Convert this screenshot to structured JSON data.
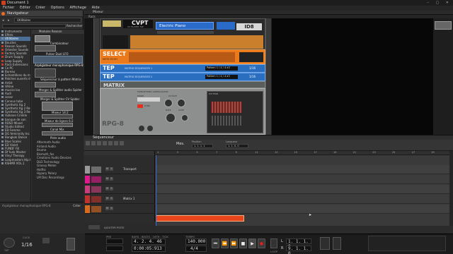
{
  "window": {
    "title": "Document 1",
    "controls": "– ▢ ✕"
  },
  "menu": [
    "Fichier",
    "Editer",
    "Créer",
    "Options",
    "Affichage",
    "Aide"
  ],
  "browser": {
    "title": "Navigateur",
    "search_field": "Utilitaires",
    "location_label": "Rechercher",
    "locations": [
      "Instruments",
      "Effets",
      "Utilitaires",
      "Boucles",
      "Reason Sounds",
      "Orkester Sounds",
      "Factory Sounds",
      "Drum Supply",
      "Loop Supply",
      "Rack Extensions",
      "Ce PC",
      "Bureau",
      "Echantillons du modèle",
      "Patches ouverts dans",
      "Artist",
      "Véline",
      "musics loo",
      "Audi",
      "sonar",
      "Connus tube",
      "Synthetic Kg 2",
      "Synthetic Kg 2 ReFill",
      "Synthetic Kg 3 ReFill",
      "Vulkane Crinkle",
      "banque de son",
      "RDSO Mixed",
      "Studio Edited",
      "ED Femme",
      "DG femininity Inc",
      "Bangkok Dance",
      "Blue Scales",
      "ED Violet",
      "FUNDF Fill",
      "Df funk Master",
      "Vinyl Therapy",
      "Loopmasters Hip Hop",
      "KSHMR VOL.1"
    ],
    "selected_location": "Utilitaires",
    "column_header": "Modules Reason",
    "devices": [
      "Combinateur",
      "Pulsar Dual LFO",
      "Arpégiateur monophonique RPG-8",
      "Séquenceur à pattern Matrix",
      "Merger & Splitter audio Spider",
      "Merger & Splitter CV Spider",
      "Mixeur 14:2",
      "Mixeur de lignes 6:2",
      "Canal Mix",
      "Piste audio"
    ],
    "more_items": [
      "Aftermath Audio",
      "Airland Audio",
      "Brume",
      "Bismuth_fas",
      "Creations Audio Devices",
      "DLD Technology",
      "Groovy Melon",
      "Halfhz",
      "Hypary Polary",
      "LM Disc Recordings"
    ],
    "footer": "Arpégiateur monophonique RPG-8",
    "footer_button": "Créer"
  },
  "rack": {
    "title": "Mixeur",
    "sub": "Rack",
    "cv_player": {
      "brand": "CVPT",
      "model": "CV PLAYER TAP",
      "id_badge": "ID8",
      "patch": "Electric Piano",
      "pan_label": "Pan",
      "vol_label": "Volume"
    },
    "select": {
      "name": "SELECT",
      "sub": "NOTE ECHO"
    },
    "step_modules": [
      {
        "name": "TEP",
        "label": "MATRIX SEQUENCER 1",
        "field": "Pattern 1 / 4 / 4 a3",
        "value": "1/16"
      },
      {
        "name": "TEP",
        "label": "MATRIX SEQUENCER 2",
        "field": "Pattern 1 / 4 / 4 a3",
        "value": "1/16"
      }
    ],
    "matrix": {
      "name": "MATRIX"
    },
    "arpeggiator": {
      "name": "RPG-8",
      "title": "MONOPHONIC ARPEGGIATOR",
      "mode_label": "MODE",
      "rate_label": "RATE",
      "gate_label": "GATE",
      "octave_label": "OCTAVE",
      "sync_label": "SYNC",
      "pattern_label": "PATTERN"
    }
  },
  "sequencer": {
    "title": "Séquenceur",
    "tools": [
      "Mes.",
      "Position",
      "Longueur"
    ],
    "position": "1.  1.  1.  1",
    "length": "1.  1.  0.  0",
    "ruler": [
      "1",
      "3",
      "5",
      "7",
      "9",
      "11",
      "13",
      "15",
      "17",
      "19",
      "21",
      "23",
      "25",
      "27",
      "29"
    ],
    "tracks": [
      {
        "name": "Transport",
        "color": "#999999"
      },
      {
        "name": "",
        "color": "#e0198c"
      },
      {
        "name": "",
        "color": "#c83d7a"
      },
      {
        "name": "Matrix 1",
        "color": "#c2322c"
      },
      {
        "name": "",
        "color": "#d86a1e"
      }
    ],
    "clip_color": "#e8461a",
    "footer_label": "AJOUTER PISTE"
  },
  "transport": {
    "tap": "TAP",
    "click_pre": "1/16",
    "position_bars": "4. 2. 4. 46",
    "position_time": "0:00:05:913",
    "tempo": "140.000",
    "signature": "4/4",
    "left_loc": "1. 1. 1. 0",
    "right_loc": "9. 1. 1. 0",
    "l_label": "L",
    "r_label": "R",
    "buttons": [
      "⏮",
      "⏪",
      "⏩",
      "■",
      "▶",
      "●"
    ],
    "labels": {
      "pre": "PRE",
      "bars": "BARS . BEATS . 16TH . TICK",
      "time": "TIME",
      "tempo": "TEMPO",
      "sig": "SIGNATURE",
      "click": "CLICK",
      "loop": "LOOP"
    }
  }
}
